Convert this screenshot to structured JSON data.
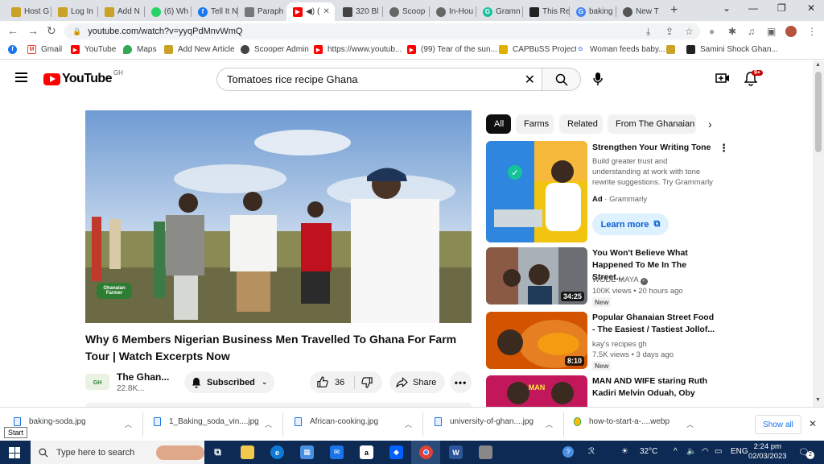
{
  "browser": {
    "tabs": [
      {
        "label": "Host G",
        "active": false
      },
      {
        "label": "Log In",
        "active": false
      },
      {
        "label": "Add N",
        "active": false
      },
      {
        "label": "(6) Wh",
        "active": false
      },
      {
        "label": "Tell It N",
        "active": false
      },
      {
        "label": "Paraph",
        "active": false
      },
      {
        "label": "(",
        "active": true
      },
      {
        "label": "320 Bl",
        "active": false
      },
      {
        "label": "Scoop",
        "active": false
      },
      {
        "label": "In-Hou",
        "active": false
      },
      {
        "label": "Gramn",
        "active": false
      },
      {
        "label": "This Re",
        "active": false
      },
      {
        "label": "baking",
        "active": false
      },
      {
        "label": "New T",
        "active": false
      }
    ],
    "url": "youtube.com/watch?v=yyqPdMnvWmQ",
    "bookmarks": [
      {
        "label": "Gmail",
        "icon": "gmail-icon"
      },
      {
        "label": "YouTube",
        "icon": "youtube-icon"
      },
      {
        "label": "Maps",
        "icon": "maps-icon"
      },
      {
        "label": "Add New Article",
        "icon": "site-icon"
      },
      {
        "label": "Scooper Admin",
        "icon": "scooper-icon"
      },
      {
        "label": "https://www.youtub...",
        "icon": "youtube-icon"
      },
      {
        "label": "(99) Tear of the sun...",
        "icon": "youtube-icon"
      },
      {
        "label": "CAPBuSS Project",
        "icon": "capbuss-icon"
      },
      {
        "label": "Woman feeds baby...",
        "icon": "google-icon"
      },
      {
        "label": "Samini Shock Ghan...",
        "icon": "site-icon"
      }
    ]
  },
  "youtube": {
    "logo_text": "YouTube",
    "country_code": "GH",
    "search_query": "Tomatoes rice recipe Ghana",
    "notification_count": "9+",
    "video": {
      "title": "Why 6 Members Nigerian Business Men Travelled To Ghana For Farm Tour | Watch Excerpts Now",
      "channel_name": "The Ghan...",
      "subscribers": "22.8K...",
      "subscribe_label": "Subscribed",
      "likes": "36",
      "share_label": "Share",
      "watermark": "Ghanaian Farmer"
    },
    "chips": [
      "All",
      "Farms",
      "Related",
      "From The Ghanaian F"
    ],
    "recommendations": [
      {
        "title": "Strengthen Your Writing Tone",
        "description": "Build greater trust and understanding at work with tone rewrite suggestions. Try Grammarly",
        "ad_label": "Ad",
        "advertiser": "Grammarly",
        "cta": "Learn more"
      },
      {
        "title": "You Won't Believe What Happened To Me In The Street...",
        "channel": "WODE MAYA",
        "views": "100K views",
        "age": "20 hours ago",
        "badge": "New",
        "duration": "34:25"
      },
      {
        "title": "Popular Ghanaian Street Food - The Easiest / Tastiest Jollof...",
        "channel": "kay's recipes gh",
        "views": "7.5K views",
        "age": "3 days ago",
        "badge": "New",
        "duration": "8:10"
      },
      {
        "title": "MAN AND WIFE staring Ruth Kadiri Melvin Oduah, Oby titus...."
      }
    ]
  },
  "downloads": {
    "items": [
      "baking-soda.jpg",
      "1_Baking_soda_vin....jpg",
      "African-cooking.jpg",
      "university-of-ghan....jpg",
      "how-to-start-a-....webp"
    ],
    "show_all": "Show all"
  },
  "taskbar": {
    "start_tooltip": "Start",
    "search_placeholder": "Type here to search",
    "temperature": "32°C",
    "language": "ENG",
    "time": "2:24 pm",
    "date": "02/03/2023",
    "notifications": "2"
  }
}
